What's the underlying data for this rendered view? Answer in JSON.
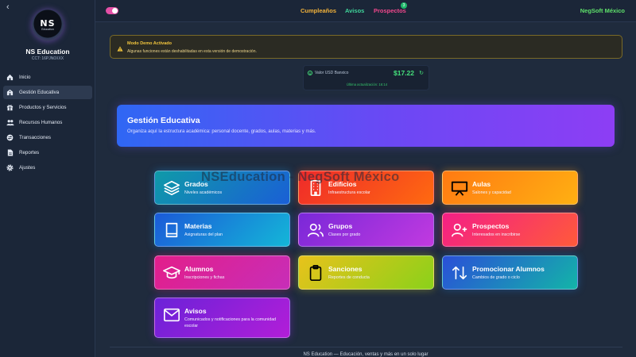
{
  "brand": {
    "name": "NS Education",
    "cct": "CCT:  16PJN0XXX",
    "logo_text": "NS",
    "logo_sub": "Education"
  },
  "sidebar": {
    "items": [
      {
        "label": "Inicio",
        "icon": "home-icon"
      },
      {
        "label": "Gestión Educativa",
        "icon": "school-icon",
        "active": true
      },
      {
        "label": "Productos y Servicios",
        "icon": "gift-icon"
      },
      {
        "label": "Recursos Humanos",
        "icon": "users-icon"
      },
      {
        "label": "Transacciones",
        "icon": "transfer-icon"
      },
      {
        "label": "Reportes",
        "icon": "file-icon"
      },
      {
        "label": "Ajustes",
        "icon": "gear-icon"
      }
    ]
  },
  "topbar": {
    "links": [
      {
        "label": "Cumpleaños",
        "color": "#f2b23a"
      },
      {
        "label": "Avisos",
        "color": "#3fd49a"
      },
      {
        "label": "Prospectos",
        "color": "#f0478c"
      }
    ],
    "prospectos_badge": "3",
    "company": "NegSoft México"
  },
  "alert": {
    "title": "Modo Demo Activado",
    "text": "Algunas funciones están deshabilitadas en esta versión de demostración."
  },
  "rate": {
    "label": "Valor USD Banxico",
    "value": "$17.22",
    "updated": "Última actualización: 16:14"
  },
  "hero": {
    "title": "Gestión Educativa",
    "subtitle": "Organiza aquí la estructura académica: personal docente, grados, aulas, materias y más."
  },
  "watermark": "NSEducation - NegSoft México",
  "cards": {
    "grados": {
      "title": "Grados",
      "subtitle": "Niveles académicos",
      "icon": "layers-icon"
    },
    "edificios": {
      "title": "Edificios",
      "subtitle": "Infraestructura escolar",
      "icon": "building-icon"
    },
    "aulas": {
      "title": "Aulas",
      "subtitle": "Salones y capacidad",
      "icon": "presentation-icon"
    },
    "materias": {
      "title": "Materias",
      "subtitle": "Asignaturas del plan",
      "icon": "book-icon"
    },
    "grupos": {
      "title": "Grupos",
      "subtitle": "Clases por grado",
      "icon": "group-icon"
    },
    "prospectos": {
      "title": "Prospectos",
      "subtitle": "Interesados en inscribirse",
      "icon": "user-plus-icon"
    },
    "alumnos": {
      "title": "Alumnos",
      "subtitle": "Inscripciones y fichas",
      "icon": "graduation-cap-icon"
    },
    "sanciones": {
      "title": "Sanciones",
      "subtitle": "Reportes de conducta",
      "icon": "clipboard-icon"
    },
    "promocionar": {
      "title": "Promocionar Alumnos",
      "subtitle": "Cambios de grado o ciclo",
      "icon": "arrows-updown-icon"
    },
    "avisos": {
      "title": "Avisos",
      "subtitle": "Comunicados y notificaciones para la comunidad escolar",
      "icon": "mail-icon"
    }
  },
  "footer": "NS Education — Educación, ventas y más en un solo lugar"
}
